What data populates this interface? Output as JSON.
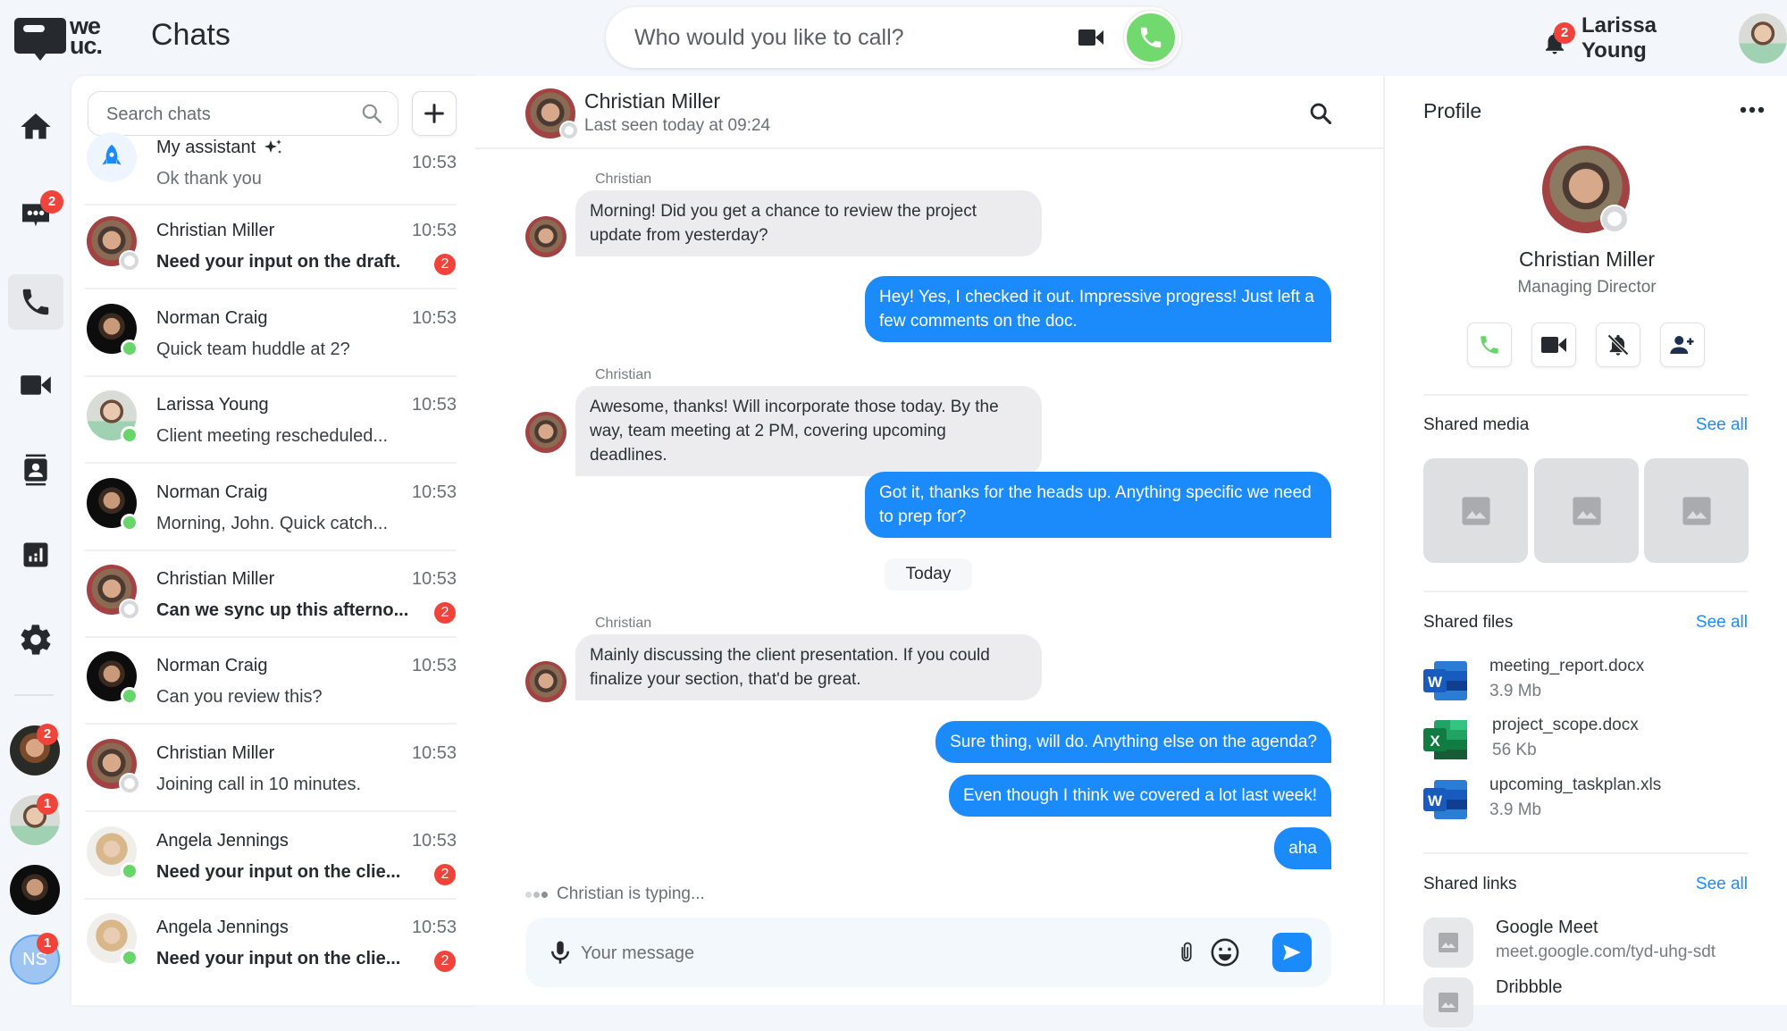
{
  "header": {
    "logo_text_line1": "we",
    "logo_text_line2": "uc.",
    "title": "Chats",
    "call_placeholder": "Who would you like to call?",
    "notifications_count": "2",
    "user_name": "Larissa Young"
  },
  "colors": {
    "accent": "#1b8bfb",
    "call_green": "#72d96f",
    "badge_red": "#f0443a",
    "online_green": "#67d56a"
  },
  "rail": {
    "items": [
      {
        "icon": "home-icon",
        "label": "Home"
      },
      {
        "icon": "chat-icon",
        "label": "Chats",
        "badge": "2"
      },
      {
        "icon": "phone-icon",
        "label": "Calls",
        "active": true
      },
      {
        "icon": "video-icon",
        "label": "Video"
      },
      {
        "icon": "contacts-icon",
        "label": "Contacts"
      },
      {
        "icon": "stats-icon",
        "label": "Statistics"
      },
      {
        "icon": "gear-icon",
        "label": "Settings"
      }
    ],
    "favorites": [
      {
        "name": "Favorite contact 1",
        "badge": "2"
      },
      {
        "name": "Larissa Young",
        "badge": "1"
      },
      {
        "name": "Norman Craig"
      },
      {
        "initials": "NS",
        "badge": "1"
      }
    ]
  },
  "chat_list": {
    "search_placeholder": "Search chats",
    "items": [
      {
        "name": "My assistant",
        "message": "Ok thank you",
        "time": "10:53",
        "bold": false
      },
      {
        "name": "Christian Miller",
        "message": "Need your input on the draft.",
        "time": "10:53",
        "unread": "2",
        "bold": true,
        "status": "offline"
      },
      {
        "name": "Norman Craig",
        "message": "Quick team huddle at 2?",
        "time": "10:53",
        "status": "online"
      },
      {
        "name": "Larissa Young",
        "message": "Client meeting rescheduled...",
        "time": "10:53",
        "status": "online"
      },
      {
        "name": "Norman Craig",
        "message": "Morning, John. Quick catch...",
        "time": "10:53",
        "status": "online"
      },
      {
        "name": "Christian Miller",
        "message": "Can we sync up this afterno...",
        "time": "10:53",
        "unread": "2",
        "bold": true,
        "status": "offline"
      },
      {
        "name": "Norman Craig",
        "message": "Can you review this?",
        "time": "10:53",
        "status": "online"
      },
      {
        "name": "Christian Miller",
        "message": "Joining call in 10 minutes.",
        "time": "10:53",
        "status": "offline"
      },
      {
        "name": "Angela Jennings",
        "message": "Need your input on the clie...",
        "time": "10:53",
        "unread": "2",
        "bold": true,
        "status": "online"
      },
      {
        "name": "Angela Jennings",
        "message": "Need your input on the clie...",
        "time": "10:53",
        "unread": "2",
        "bold": true,
        "status": "online"
      }
    ]
  },
  "conversation": {
    "contact_name": "Christian Miller",
    "last_seen": "Last seen today at 09:24",
    "messages": [
      {
        "from": "Christian",
        "dir": "in",
        "text": "Morning! Did you get a chance to review the project update from yesterday?"
      },
      {
        "dir": "out",
        "text": "Hey! Yes, I checked it out. Impressive progress! Just left a few comments on the doc."
      },
      {
        "from": "Christian",
        "dir": "in",
        "text": "Awesome, thanks! Will incorporate those today. By the way, team meeting at 2 PM, covering upcoming deadlines."
      },
      {
        "dir": "out",
        "text": "Got it, thanks for the heads up. Anything specific we need to prep for?"
      },
      {
        "from": "Christian",
        "dir": "in",
        "text": "Mainly discussing the client presentation. If you could finalize your section, that'd be great."
      },
      {
        "dir": "out",
        "text": "Sure thing, will do. Anything else on the agenda?"
      },
      {
        "dir": "out",
        "text": "Even though I think we covered a lot last week!"
      },
      {
        "dir": "out",
        "text": "aha"
      }
    ],
    "date_divider": "Today",
    "typing_indicator": "Christian is typing...",
    "composer_placeholder": "Your message"
  },
  "profile": {
    "title": "Profile",
    "name": "Christian Miller",
    "role": "Managing Director",
    "actions": [
      "Call",
      "Video call",
      "Mute notifications",
      "Add contact"
    ],
    "shared_media": {
      "title": "Shared media",
      "see_all": "See all",
      "count": 3
    },
    "shared_files": {
      "title": "Shared files",
      "see_all": "See all",
      "items": [
        {
          "name": "meeting_report.docx",
          "size": "3.9 Mb",
          "type": "word"
        },
        {
          "name": "project_scope.docx",
          "size": "56 Kb",
          "type": "excel"
        },
        {
          "name": "upcoming_taskplan.xls",
          "size": "3.9 Mb",
          "type": "word"
        }
      ]
    },
    "shared_links": {
      "title": "Shared links",
      "see_all": "See all",
      "items": [
        {
          "title": "Google Meet",
          "url": "meet.google.com/tyd-uhg-sdt"
        },
        {
          "title": "Dribbble",
          "url": ""
        }
      ]
    }
  }
}
